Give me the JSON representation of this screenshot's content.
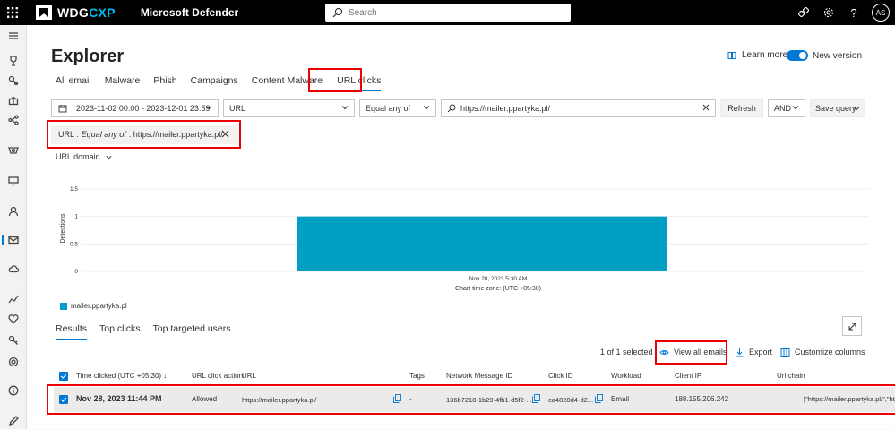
{
  "topbar": {
    "brand_prefix": "WDG",
    "brand_suffix": "CXP",
    "product": "Microsoft Defender",
    "search_placeholder": "Search",
    "avatar_initials": "AS"
  },
  "page": {
    "title": "Explorer",
    "learn_more": "Learn more",
    "new_version": "New version"
  },
  "tabs": [
    "All email",
    "Malware",
    "Phish",
    "Campaigns",
    "Content Malware",
    "URL clicks"
  ],
  "filter": {
    "date_range": "2023-11-02 00:00 - 2023-12-01 23:59",
    "field": "URL",
    "operator": "Equal any of",
    "value": "https://mailer.ppartyka.pl/",
    "refresh": "Refresh",
    "logic": "AND",
    "save_query": "Save query"
  },
  "chip": {
    "field": "URL :",
    "operator": "Equal any of",
    "value": ": https://mailer.ppartyka.pl/"
  },
  "group_by": "URL domain",
  "chart_data": {
    "type": "bar",
    "categories": [
      "Nov 28, 2023 5:30 AM"
    ],
    "series": [
      {
        "name": "mailer.ppartyka.pl",
        "values": [
          1
        ]
      }
    ],
    "ylabel": "Detections",
    "yticks": [
      "1.5",
      "1",
      "0.5",
      "0"
    ],
    "ylim": [
      0,
      1.5
    ],
    "footnote": "Chart time zone: (UTC +05:30)",
    "color": "#009fc4"
  },
  "results_tabs": [
    "Results",
    "Top clicks",
    "Top targeted users"
  ],
  "selection": {
    "count_text": "1 of 1 selected",
    "view_all_emails": "View all emails",
    "export": "Export",
    "customize_columns": "Customize columns"
  },
  "table": {
    "headers": {
      "time": "Time clicked (UTC +05:30)",
      "action": "URL click action",
      "url": "URL",
      "tags": "Tags",
      "message_id": "Network Message ID",
      "click_id": "Click ID",
      "workload": "Workload",
      "client_ip": "Client IP",
      "url_chain": "Url chain"
    },
    "rows": [
      {
        "time": "Nov 28, 2023 11:44 PM",
        "action": "Allowed",
        "url": "https://mailer.ppartyka.pl/",
        "tags": "-",
        "message_id": "136b7218-1b29-4fb1-d5f2-...",
        "click_id": "ca4828d4-d2...",
        "workload": "Email",
        "client_ip": "188.155.206.242",
        "url_chain": "[\"https://mailer.ppartyka.pl/\",\"https://m"
      }
    ]
  }
}
